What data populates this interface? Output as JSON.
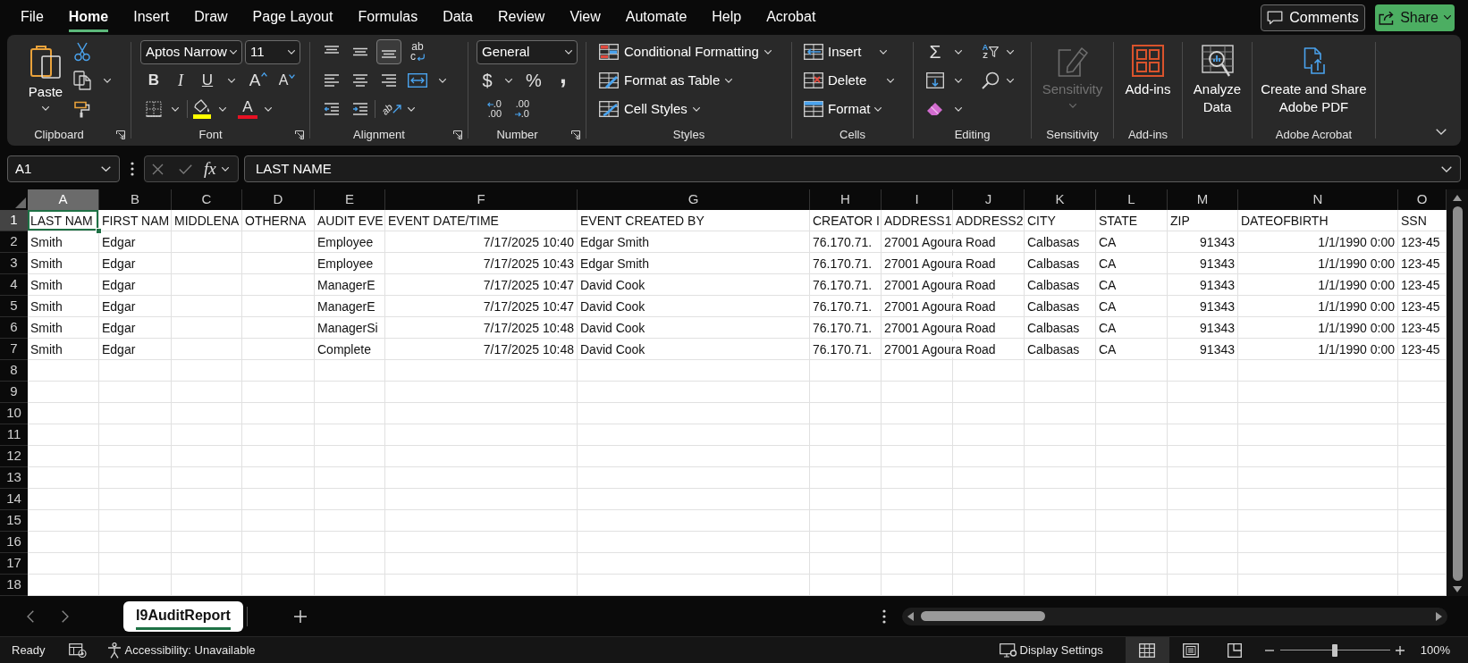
{
  "menu_bar": {
    "tabs": [
      {
        "label": "File",
        "selected": false
      },
      {
        "label": "Home",
        "selected": true
      },
      {
        "label": "Insert",
        "selected": false
      },
      {
        "label": "Draw",
        "selected": false
      },
      {
        "label": "Page Layout",
        "selected": false
      },
      {
        "label": "Formulas",
        "selected": false
      },
      {
        "label": "Data",
        "selected": false
      },
      {
        "label": "Review",
        "selected": false
      },
      {
        "label": "View",
        "selected": false
      },
      {
        "label": "Automate",
        "selected": false
      },
      {
        "label": "Help",
        "selected": false
      },
      {
        "label": "Acrobat",
        "selected": false
      }
    ],
    "comments_button": "Comments",
    "share_button": "Share"
  },
  "ribbon": {
    "clipboard": {
      "paste_button": "Paste",
      "label": "Clipboard"
    },
    "font": {
      "font_name": "Aptos Narrow",
      "font_size": "11",
      "bold": "B",
      "italic": "I",
      "underline": "U",
      "grow_font": "A",
      "shrink_font": "A",
      "font_color": "A",
      "label": "Font"
    },
    "alignment": {
      "vertical": [
        {
          "selected": false
        },
        {
          "selected": false
        },
        {
          "selected": true
        }
      ],
      "wrap_text": [
        "ab",
        "c"
      ],
      "horizontal": [
        {
          "selected": false
        },
        {
          "selected": false
        },
        {
          "selected": false
        }
      ],
      "orientation": "ab",
      "label": "Alignment"
    },
    "number": {
      "format": "General",
      "currency": "$",
      "percent": "%",
      "comma": ",",
      "increase_decimal": [
        ".0",
        ".00"
      ],
      "decrease_decimal": [
        ".00",
        ".0"
      ],
      "label": "Number"
    },
    "styles": {
      "buttons": [
        "Conditional Formatting",
        "Format as Table",
        "Cell Styles"
      ],
      "label": "Styles"
    },
    "cells": {
      "buttons": [
        "Insert",
        "Delete",
        "Format"
      ],
      "label": "Cells"
    },
    "editing": {
      "autosum": "Σ",
      "sort": [
        "A",
        "Z"
      ],
      "label": "Editing"
    },
    "sensitivity": {
      "button": "Sensitivity",
      "disabled": true,
      "label": "Sensitivity"
    },
    "add_ins": {
      "button": "Add-ins",
      "label": "Add-ins"
    },
    "analyze_data": {
      "button": "Analyze Data"
    },
    "adobe_acrobat": {
      "button": "Create and Share Adobe PDF",
      "label": "Adobe Acrobat"
    }
  },
  "formula_bar": {
    "name_box": "A1",
    "function_glyph": "fx",
    "formula": "LAST NAME"
  },
  "sheet": {
    "columns": [
      {
        "label": "A",
        "selected": true
      },
      {
        "label": "B",
        "selected": false
      },
      {
        "label": "C",
        "selected": false
      },
      {
        "label": "D",
        "selected": false
      },
      {
        "label": "E",
        "selected": false
      },
      {
        "label": "F",
        "selected": false
      },
      {
        "label": "G",
        "selected": false
      },
      {
        "label": "H",
        "selected": false
      },
      {
        "label": "I",
        "selected": false
      },
      {
        "label": "J",
        "selected": false
      },
      {
        "label": "K",
        "selected": false
      },
      {
        "label": "L",
        "selected": false
      },
      {
        "label": "M",
        "selected": false
      },
      {
        "label": "N",
        "selected": false
      },
      {
        "label": "O",
        "selected": false
      }
    ],
    "rows": [
      {
        "number": "1",
        "selected": true,
        "cells": [
          "LAST NAM",
          "FIRST NAM",
          "MIDDLENA",
          "OTHERNA",
          "AUDIT EVE",
          "EVENT DATE/TIME",
          "EVENT CREATED BY",
          "CREATOR I",
          "ADDRESS1",
          "ADDRESS2",
          "CITY",
          "STATE",
          "ZIP",
          "DATEOFBIRTH",
          "SSN"
        ]
      },
      {
        "number": "2",
        "selected": false,
        "cells": [
          "Smith",
          "Edgar",
          null,
          null,
          "Employee",
          {
            "text": "7/17/2025 10:40",
            "right_aligned": true
          },
          "Edgar Smith",
          "76.170.71.",
          "27001 Agoura Road",
          null,
          "Calbasas",
          "CA",
          {
            "text": "91343",
            "right_aligned": true
          },
          {
            "text": "1/1/1990 0:00",
            "right_aligned": true
          },
          "123-45"
        ]
      },
      {
        "number": "3",
        "selected": false,
        "cells": [
          "Smith",
          "Edgar",
          null,
          null,
          "Employee",
          {
            "text": "7/17/2025 10:43",
            "right_aligned": true
          },
          "Edgar Smith",
          "76.170.71.",
          "27001 Agoura Road",
          null,
          "Calbasas",
          "CA",
          {
            "text": "91343",
            "right_aligned": true
          },
          {
            "text": "1/1/1990 0:00",
            "right_aligned": true
          },
          "123-45"
        ]
      },
      {
        "number": "4",
        "selected": false,
        "cells": [
          "Smith",
          "Edgar",
          null,
          null,
          "ManagerE",
          {
            "text": "7/17/2025 10:47",
            "right_aligned": true
          },
          "David Cook",
          "76.170.71.",
          "27001 Agoura Road",
          null,
          "Calbasas",
          "CA",
          {
            "text": "91343",
            "right_aligned": true
          },
          {
            "text": "1/1/1990 0:00",
            "right_aligned": true
          },
          "123-45"
        ]
      },
      {
        "number": "5",
        "selected": false,
        "cells": [
          "Smith",
          "Edgar",
          null,
          null,
          "ManagerE",
          {
            "text": "7/17/2025 10:47",
            "right_aligned": true
          },
          "David Cook",
          "76.170.71.",
          "27001 Agoura Road",
          null,
          "Calbasas",
          "CA",
          {
            "text": "91343",
            "right_aligned": true
          },
          {
            "text": "1/1/1990 0:00",
            "right_aligned": true
          },
          "123-45"
        ]
      },
      {
        "number": "6",
        "selected": false,
        "cells": [
          "Smith",
          "Edgar",
          null,
          null,
          "ManagerSi",
          {
            "text": "7/17/2025 10:48",
            "right_aligned": true
          },
          "David Cook",
          "76.170.71.",
          "27001 Agoura Road",
          null,
          "Calbasas",
          "CA",
          {
            "text": "91343",
            "right_aligned": true
          },
          {
            "text": "1/1/1990 0:00",
            "right_aligned": true
          },
          "123-45"
        ]
      },
      {
        "number": "7",
        "selected": false,
        "cells": [
          "Smith",
          "Edgar",
          null,
          null,
          "Complete",
          {
            "text": "7/17/2025 10:48",
            "right_aligned": true
          },
          "David Cook",
          "76.170.71.",
          "27001 Agoura Road",
          null,
          "Calbasas",
          "CA",
          {
            "text": "91343",
            "right_aligned": true
          },
          {
            "text": "1/1/1990 0:00",
            "right_aligned": true
          },
          "123-45"
        ]
      },
      {
        "number": "8",
        "selected": false
      },
      {
        "number": "9",
        "selected": false
      },
      {
        "number": "10",
        "selected": false
      },
      {
        "number": "11",
        "selected": false
      },
      {
        "number": "12",
        "selected": false
      },
      {
        "number": "13",
        "selected": false
      },
      {
        "number": "14",
        "selected": false
      },
      {
        "number": "15",
        "selected": false
      },
      {
        "number": "16",
        "selected": false
      },
      {
        "number": "17",
        "selected": false
      },
      {
        "number": "18",
        "selected": false
      }
    ]
  },
  "sheet_tabs": [
    {
      "label": "I9AuditReport",
      "selected": true
    }
  ],
  "status_bar": {
    "mode": "Ready",
    "accessibility": "Accessibility: Unavailable",
    "display_settings": "Display Settings",
    "views": [
      {
        "kind": "normal",
        "selected": true
      },
      {
        "kind": "page-layout",
        "selected": false
      },
      {
        "kind": "page-break-preview",
        "selected": false
      }
    ],
    "zoom": {
      "level": 0.5,
      "reading": "100%"
    }
  }
}
